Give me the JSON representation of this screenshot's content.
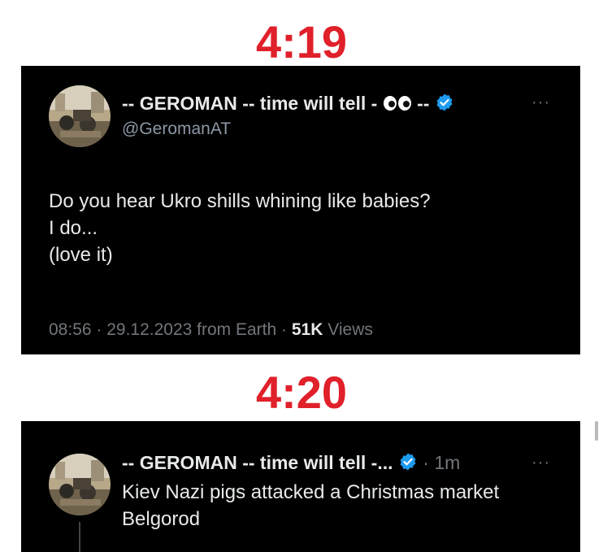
{
  "labels": {
    "top_time": "4:19",
    "bottom_time": "4:20"
  },
  "tweet1": {
    "name_prefix": "-- GEROMAN -- time will tell -",
    "name_suffix": "--",
    "handle": "@GeromanAT",
    "more": "···",
    "lines": [
      "Do you hear Ukro shills whining like babies?",
      "I do...",
      "(love it)"
    ],
    "time_date_location": "08:56 · 29.12.2023 from Earth ·",
    "views_count": "51K",
    "views_label": "Views"
  },
  "tweet2": {
    "name": "-- GEROMAN -- time will tell -...",
    "age": "· 1m",
    "more": "···",
    "lines": [
      "Kiev Nazi pigs attacked a Christmas market",
      "Belgorod"
    ]
  },
  "colors": {
    "time_label": "#e0202a",
    "verified": "#1d9bf0",
    "tweet_bg": "#000000"
  }
}
